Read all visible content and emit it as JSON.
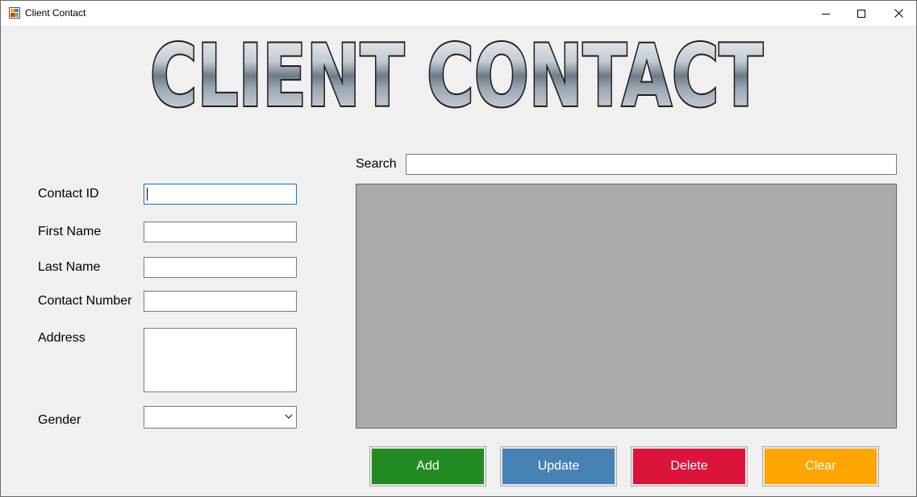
{
  "window": {
    "title": "Client Contact"
  },
  "banner": {
    "text": "CLIENT CONTACT"
  },
  "form": {
    "contact_id_label": "Contact ID",
    "contact_id_value": "",
    "first_name_label": "First Name",
    "first_name_value": "",
    "last_name_label": "Last Name",
    "last_name_value": "",
    "contact_number_label": "Contact Number",
    "contact_number_value": "",
    "address_label": "Address",
    "address_value": "",
    "gender_label": "Gender",
    "gender_value": ""
  },
  "search": {
    "label": "Search",
    "value": ""
  },
  "actions": {
    "add_label": "Add",
    "update_label": "Update",
    "delete_label": "Delete",
    "clear_label": "Clear"
  },
  "colors": {
    "add": "#228b22",
    "update": "#4682b4",
    "delete": "#dc143c",
    "clear": "#ffa500",
    "grid_background": "#ababab"
  },
  "icons": {
    "app": "app-icon",
    "minimize": "minimize-icon",
    "maximize": "maximize-icon",
    "close": "close-icon",
    "dropdown": "chevron-down-icon"
  }
}
